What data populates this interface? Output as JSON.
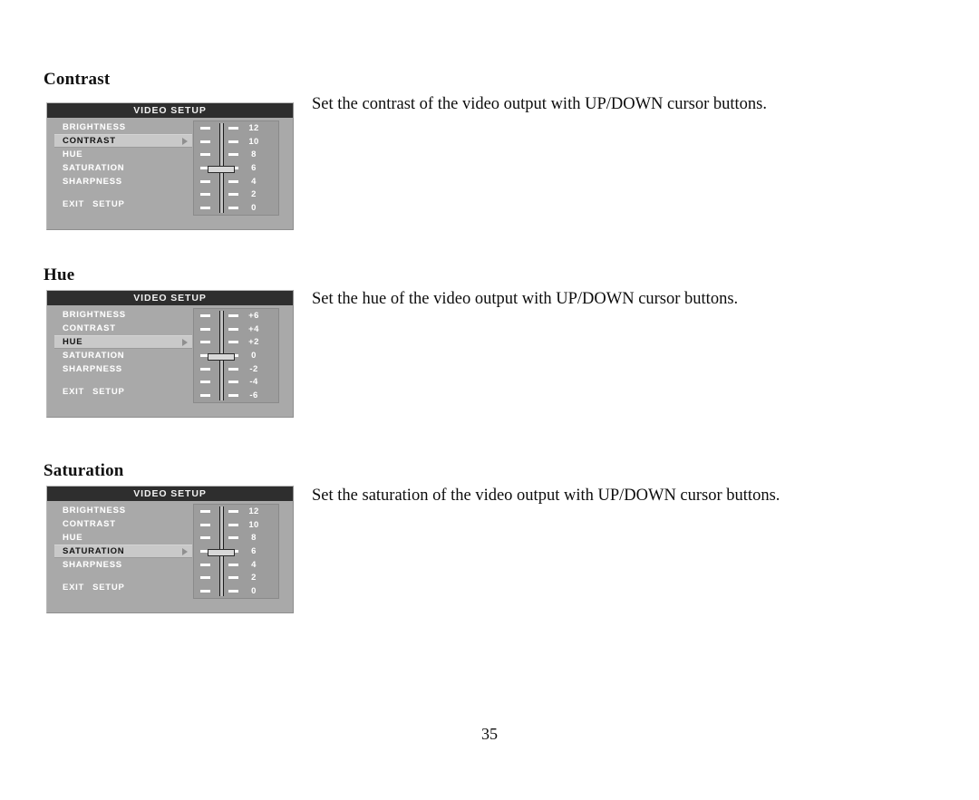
{
  "document": {
    "page_number": "35"
  },
  "sections": [
    {
      "heading": "Contrast",
      "description": "Set the contrast of the video output with UP/DOWN cursor buttons.",
      "osd": {
        "title": "VIDEO SETUP",
        "items": [
          {
            "label": "BRIGHTNESS",
            "selected": false
          },
          {
            "label": "CONTRAST",
            "selected": true
          },
          {
            "label": "HUE",
            "selected": false
          },
          {
            "label": "SATURATION",
            "selected": false
          },
          {
            "label": "SHARPNESS",
            "selected": false
          }
        ],
        "exit_label": "EXIT",
        "setup_label": "SETUP",
        "scale": [
          "12",
          "10",
          "8",
          "6",
          "4",
          "2",
          "0"
        ],
        "thumb_value": "6",
        "thumb_row_index": 3
      }
    },
    {
      "heading": "Hue",
      "description": "Set the hue of the video output with UP/DOWN cursor buttons.",
      "osd": {
        "title": "VIDEO SETUP",
        "items": [
          {
            "label": "BRIGHTNESS",
            "selected": false
          },
          {
            "label": "CONTRAST",
            "selected": false
          },
          {
            "label": "HUE",
            "selected": true
          },
          {
            "label": "SATURATION",
            "selected": false
          },
          {
            "label": "SHARPNESS",
            "selected": false
          }
        ],
        "exit_label": "EXIT",
        "setup_label": "SETUP",
        "scale": [
          "+6",
          "+4",
          "+2",
          "0",
          "-2",
          "-4",
          "-6"
        ],
        "thumb_value": "0",
        "thumb_row_index": 3
      }
    },
    {
      "heading": "Saturation",
      "description": "Set the saturation of the video output with UP/DOWN cursor buttons.",
      "osd": {
        "title": "VIDEO SETUP",
        "items": [
          {
            "label": "BRIGHTNESS",
            "selected": false
          },
          {
            "label": "CONTRAST",
            "selected": false
          },
          {
            "label": "HUE",
            "selected": false
          },
          {
            "label": "SATURATION",
            "selected": true
          },
          {
            "label": "SHARPNESS",
            "selected": false
          }
        ],
        "exit_label": "EXIT",
        "setup_label": "SETUP",
        "scale": [
          "12",
          "10",
          "8",
          "6",
          "4",
          "2",
          "0"
        ],
        "thumb_value": "6",
        "thumb_row_index": 3
      }
    }
  ],
  "colors": {
    "osd_body": "#a9a9a9",
    "osd_titlebar": "#2e2e2e",
    "osd_highlight": "#c9c9c9",
    "osd_slider_block": "#9d9d9d",
    "osd_text": "#ffffff"
  }
}
